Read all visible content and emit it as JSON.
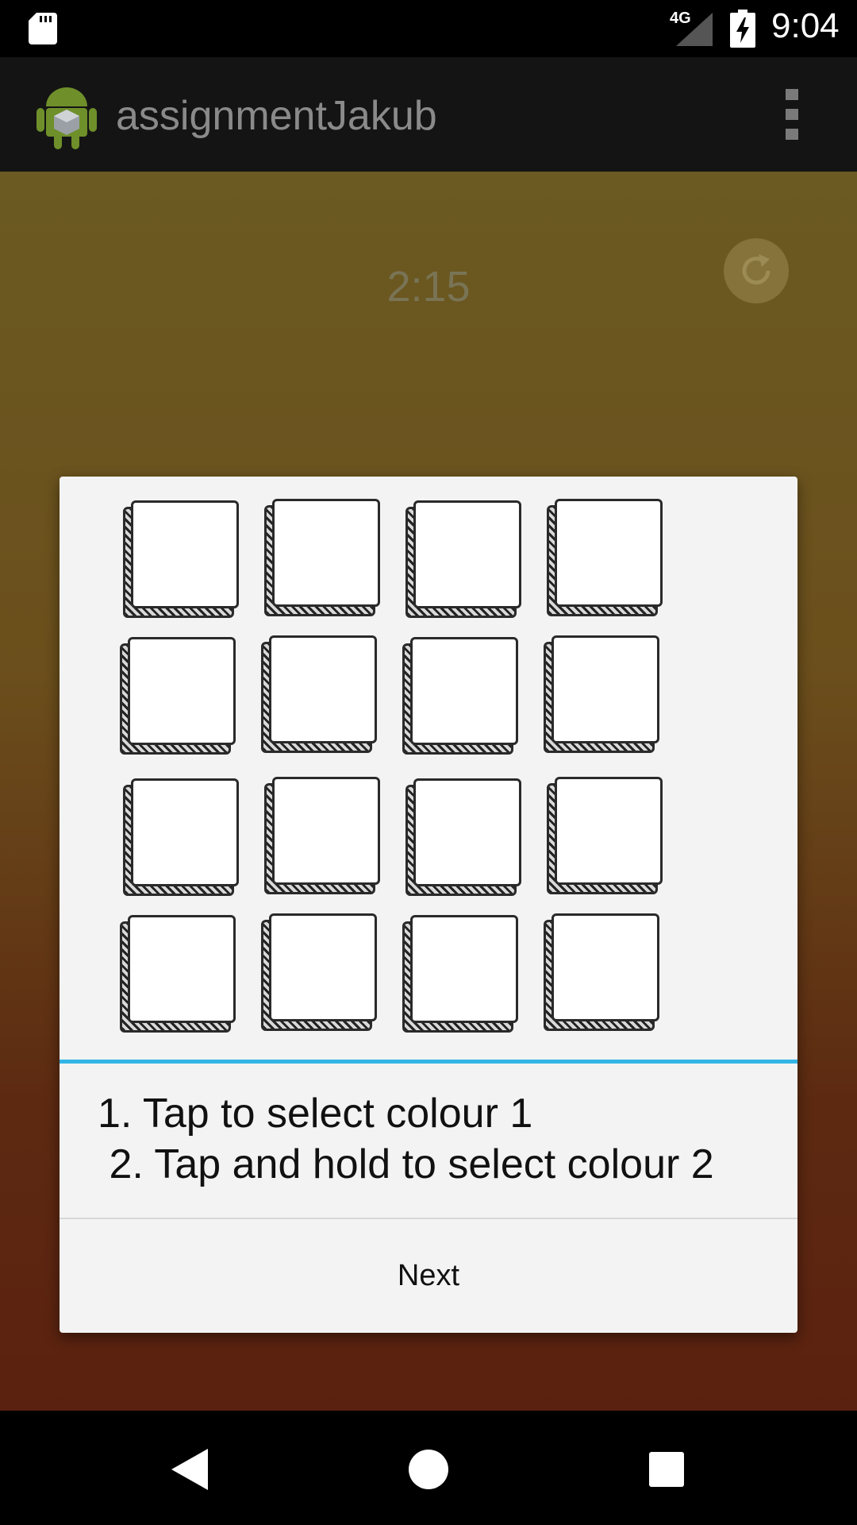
{
  "status_bar": {
    "network": "4G",
    "time": "9:04",
    "icons": [
      "sd-card-icon",
      "signal-icon",
      "battery-charging-icon"
    ]
  },
  "app_bar": {
    "title": "assignmentJakub",
    "icons": [
      "android-app-icon",
      "overflow-menu-icon"
    ]
  },
  "content": {
    "timer": "2:15",
    "refresh_icon": "refresh-icon"
  },
  "dialog": {
    "tile_grid": {
      "rows": 4,
      "columns": 4
    },
    "instruction_line_1": "1. Tap to select colour 1",
    "instruction_line_2": " 2. Tap and hold to select colour 2",
    "next_label": "Next",
    "accent_color": "#33b5e5"
  },
  "nav_bar": {
    "icons": [
      "back-icon",
      "home-icon",
      "recents-icon"
    ]
  }
}
